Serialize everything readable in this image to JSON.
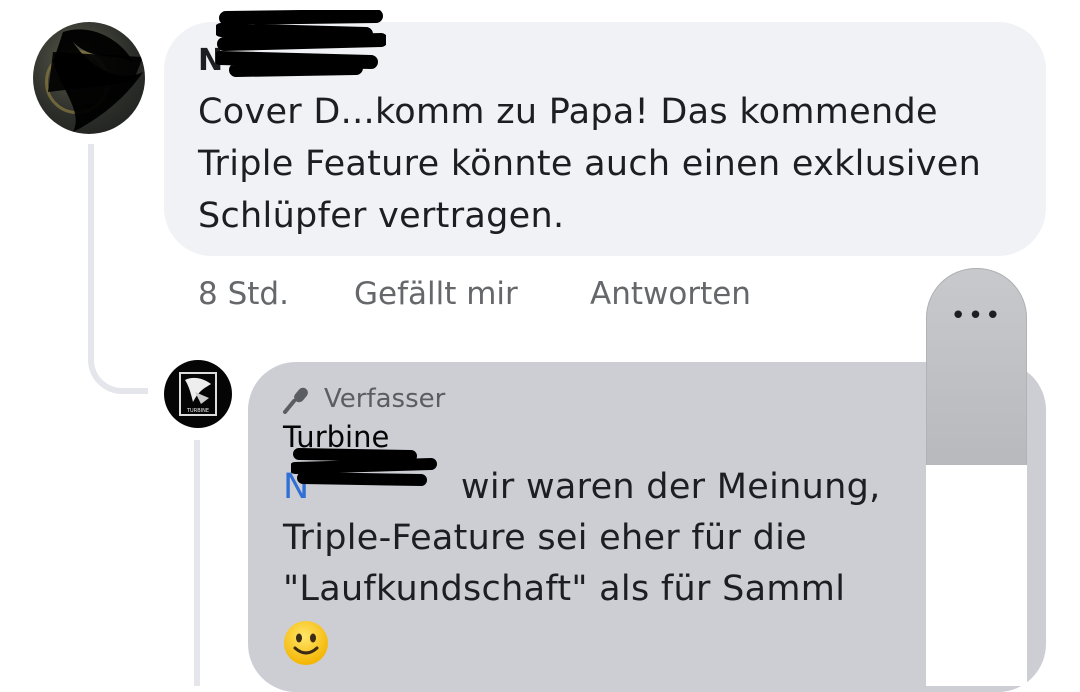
{
  "comment": {
    "author_visible": "N",
    "text": "Cover D...komm zu Papa! Das kommende Triple Feature könnte auch einen exklusiven Schlüpfer vertragen.",
    "time": "8 Std.",
    "like_label": "Gefällt mir",
    "reply_label": "Antworten"
  },
  "reply": {
    "badge_label": "Verfasser",
    "badge_icon": "microphone-icon",
    "author": "Turbine",
    "avatar_text": "TURBINE",
    "mention_visible": "N",
    "text_line1": " wir waren der Meinung,",
    "text_line2": "Triple-Feature sei eher für die",
    "text_line3": "\"Laufkundschaft\" als für Samml",
    "emoji": "smiling-face-emoji"
  },
  "more_button": {
    "label": "•••",
    "icon": "more-dots-icon"
  },
  "colors": {
    "bubble_primary": "#f0f2f5",
    "bubble_reply": "#ccced3",
    "mention_blue": "#2f6fd6",
    "meta_gray": "#65676b"
  }
}
